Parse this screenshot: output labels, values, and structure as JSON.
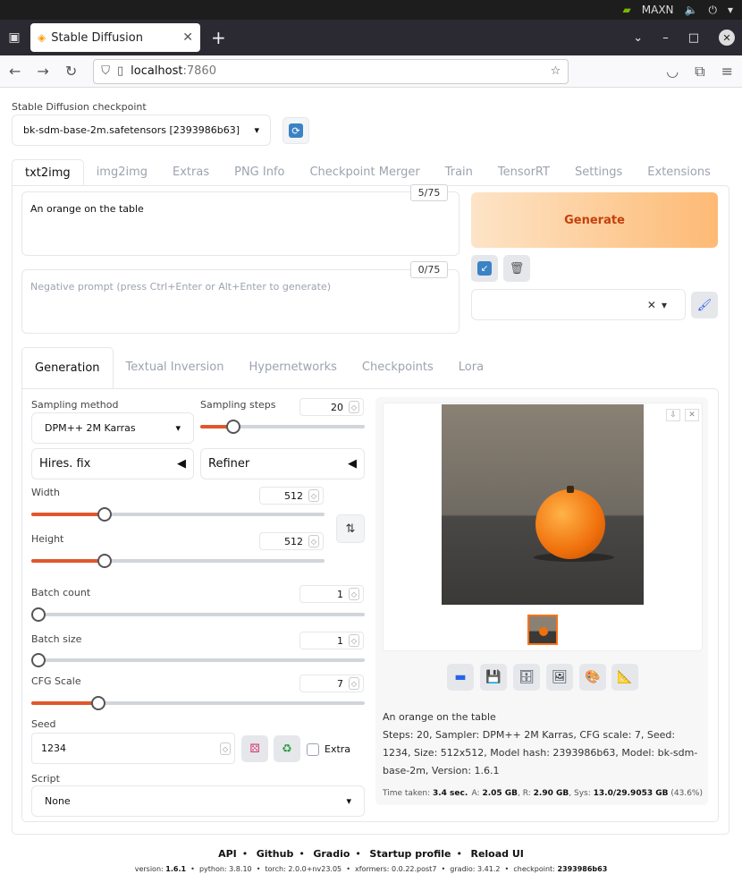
{
  "system": {
    "gpu_label": "MAXN"
  },
  "browser": {
    "tab_title": "Stable Diffusion",
    "url_host": "localhost",
    "url_port": ":7860"
  },
  "checkpoint": {
    "label": "Stable Diffusion checkpoint",
    "value": "bk-sdm-base-2m.safetensors [2393986b63]"
  },
  "main_tabs": [
    "txt2img",
    "img2img",
    "Extras",
    "PNG Info",
    "Checkpoint Merger",
    "Train",
    "TensorRT",
    "Settings",
    "Extensions"
  ],
  "prompt": {
    "value": "An orange on the table",
    "counter": "5/75"
  },
  "negative_prompt": {
    "placeholder": "Negative prompt (press Ctrl+Enter or Alt+Enter to generate)",
    "counter": "0/75"
  },
  "generate_label": "Generate",
  "sub_tabs": [
    "Generation",
    "Textual Inversion",
    "Hypernetworks",
    "Checkpoints",
    "Lora"
  ],
  "params": {
    "sampling_method_label": "Sampling method",
    "sampling_method": "DPM++ 2M Karras",
    "sampling_steps_label": "Sampling steps",
    "sampling_steps": "20",
    "hires_label": "Hires. fix",
    "refiner_label": "Refiner",
    "width_label": "Width",
    "width": "512",
    "height_label": "Height",
    "height": "512",
    "batch_count_label": "Batch count",
    "batch_count": "1",
    "batch_size_label": "Batch size",
    "batch_size": "1",
    "cfg_label": "CFG Scale",
    "cfg": "7",
    "seed_label": "Seed",
    "seed": "1234",
    "extra_label": "Extra",
    "script_label": "Script",
    "script": "None"
  },
  "sliders": {
    "steps_fraction": 0.2,
    "width_fraction": 0.25,
    "height_fraction": 0.25,
    "batch_count_fraction": 0.0,
    "batch_size_fraction": 0.0,
    "cfg_fraction": 0.2
  },
  "output": {
    "info_title": "An orange on the table",
    "info_params": "Steps: 20, Sampler: DPM++ 2M Karras, CFG scale: 7, Seed: 1234, Size: 512x512, Model hash: 2393986b63, Model: bk-sdm-base-2m, Version: 1.6.1",
    "time_label": "Time taken:",
    "time_value": "3.4 sec.",
    "mem_a_label": "A:",
    "mem_a": "2.05 GB",
    "mem_r_label": "R:",
    "mem_r": "2.90 GB",
    "mem_sys_label": "Sys:",
    "mem_sys": "13.0/29.9053 GB",
    "mem_pct": "(43.6%)"
  },
  "footer": {
    "links": [
      "API",
      "Github",
      "Gradio",
      "Startup profile",
      "Reload UI"
    ],
    "version_label": "version:",
    "version": "1.6.1",
    "python_label": "python:",
    "python": "3.8.10",
    "torch_label": "torch:",
    "torch": "2.0.0+nv23.05",
    "xformers_label": "xformers:",
    "xformers": "0.0.22.post7",
    "gradio_label": "gradio:",
    "gradio": "3.41.2",
    "checkpoint_label": "checkpoint:",
    "checkpoint": "2393986b63"
  },
  "colors": {
    "accent": "#e0572b",
    "generate_text": "#c2410c"
  }
}
